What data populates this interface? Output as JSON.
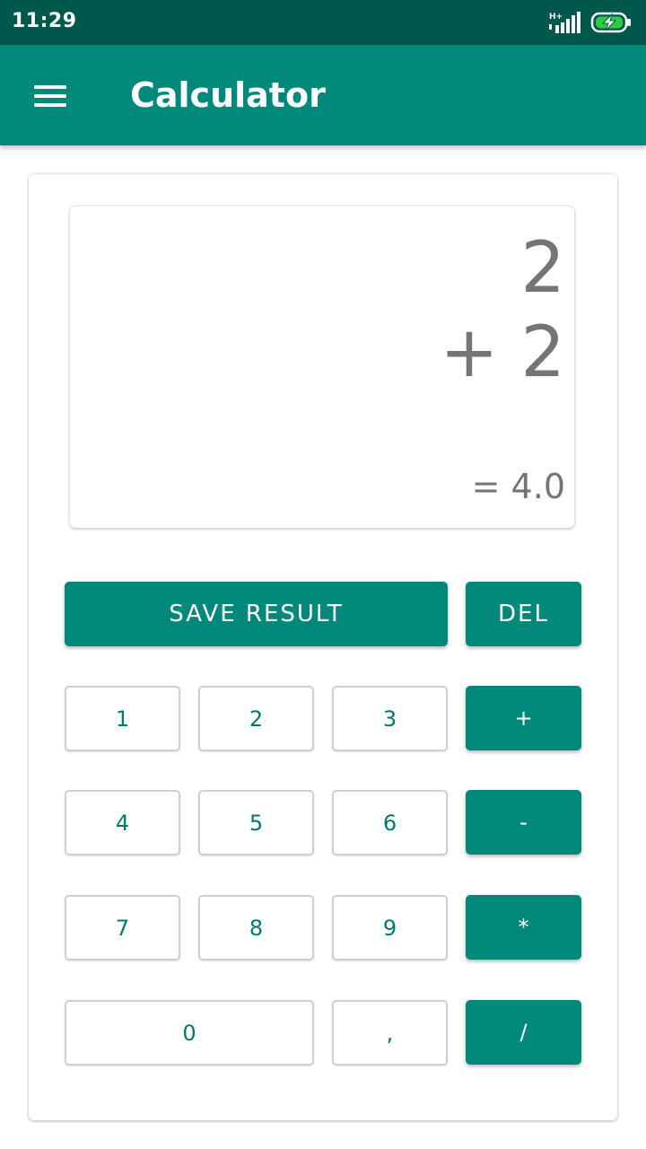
{
  "status_bar": {
    "time": "11:29",
    "network": "H+"
  },
  "app_bar": {
    "title": "Calculator"
  },
  "display": {
    "line1": "2",
    "line2": "+ 2",
    "result": "= 4.0"
  },
  "actions": {
    "save_label": "SAVE RESULT",
    "del_label": "DEL"
  },
  "keys": {
    "k1": "1",
    "k2": "2",
    "k3": "3",
    "k4": "4",
    "k5": "5",
    "k6": "6",
    "k7": "7",
    "k8": "8",
    "k9": "9",
    "k0": "0",
    "comma": ",",
    "plus": "+",
    "minus": "-",
    "multiply": "*",
    "divide": "/"
  },
  "colors": {
    "primary": "#00897b",
    "primary_dark": "#00574b",
    "text_gray": "#757575",
    "key_text": "#00796b",
    "battery_charging": "#2ecc40"
  }
}
